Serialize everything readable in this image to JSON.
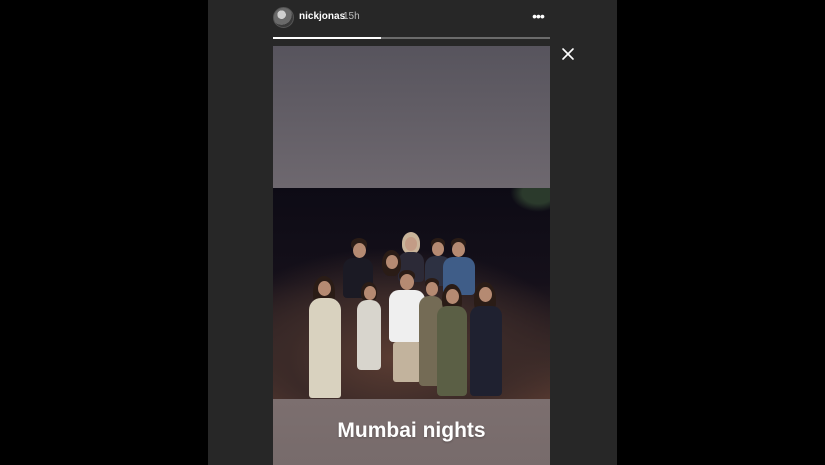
{
  "header": {
    "username": "nickjonas",
    "time": "15h",
    "more_icon": "more-horizontal-icon",
    "close_icon": "close-icon",
    "avatar_icon": "avatar-icon"
  },
  "story": {
    "progress": 0.39,
    "caption": "Mumbai nights"
  },
  "colors": {
    "background": "#000000",
    "stage": "#272727",
    "progress_track": "#6b6b6b",
    "progress_fill": "#ffffff",
    "top_band": "#6e686f",
    "bottom_band": "#7a6d6d"
  }
}
